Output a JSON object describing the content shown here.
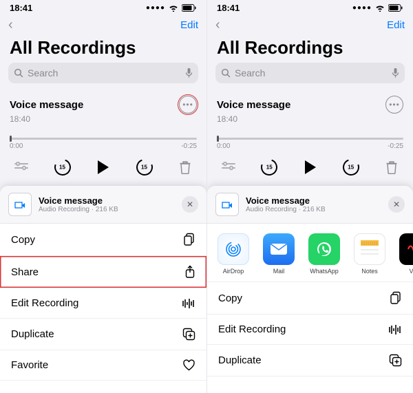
{
  "status": {
    "time": "18:41"
  },
  "nav": {
    "edit": "Edit"
  },
  "title": "All Recordings",
  "search": {
    "placeholder": "Search"
  },
  "recording": {
    "title": "Voice message",
    "time": "18:40",
    "elapsed": "0:00",
    "remaining": "-0:25",
    "skip_amount": "15"
  },
  "sheet": {
    "name": "Voice message",
    "subtitle": "Audio Recording · 216 KB"
  },
  "menuA": {
    "copy": "Copy",
    "share": "Share",
    "edit": "Edit Recording",
    "duplicate": "Duplicate",
    "favorite": "Favorite"
  },
  "apps": [
    {
      "label": "AirDrop"
    },
    {
      "label": "Mail"
    },
    {
      "label": "WhatsApp"
    },
    {
      "label": "Notes"
    },
    {
      "label": "Voic"
    }
  ],
  "menuB": {
    "copy": "Copy",
    "edit": "Edit Recording",
    "duplicate": "Duplicate"
  }
}
